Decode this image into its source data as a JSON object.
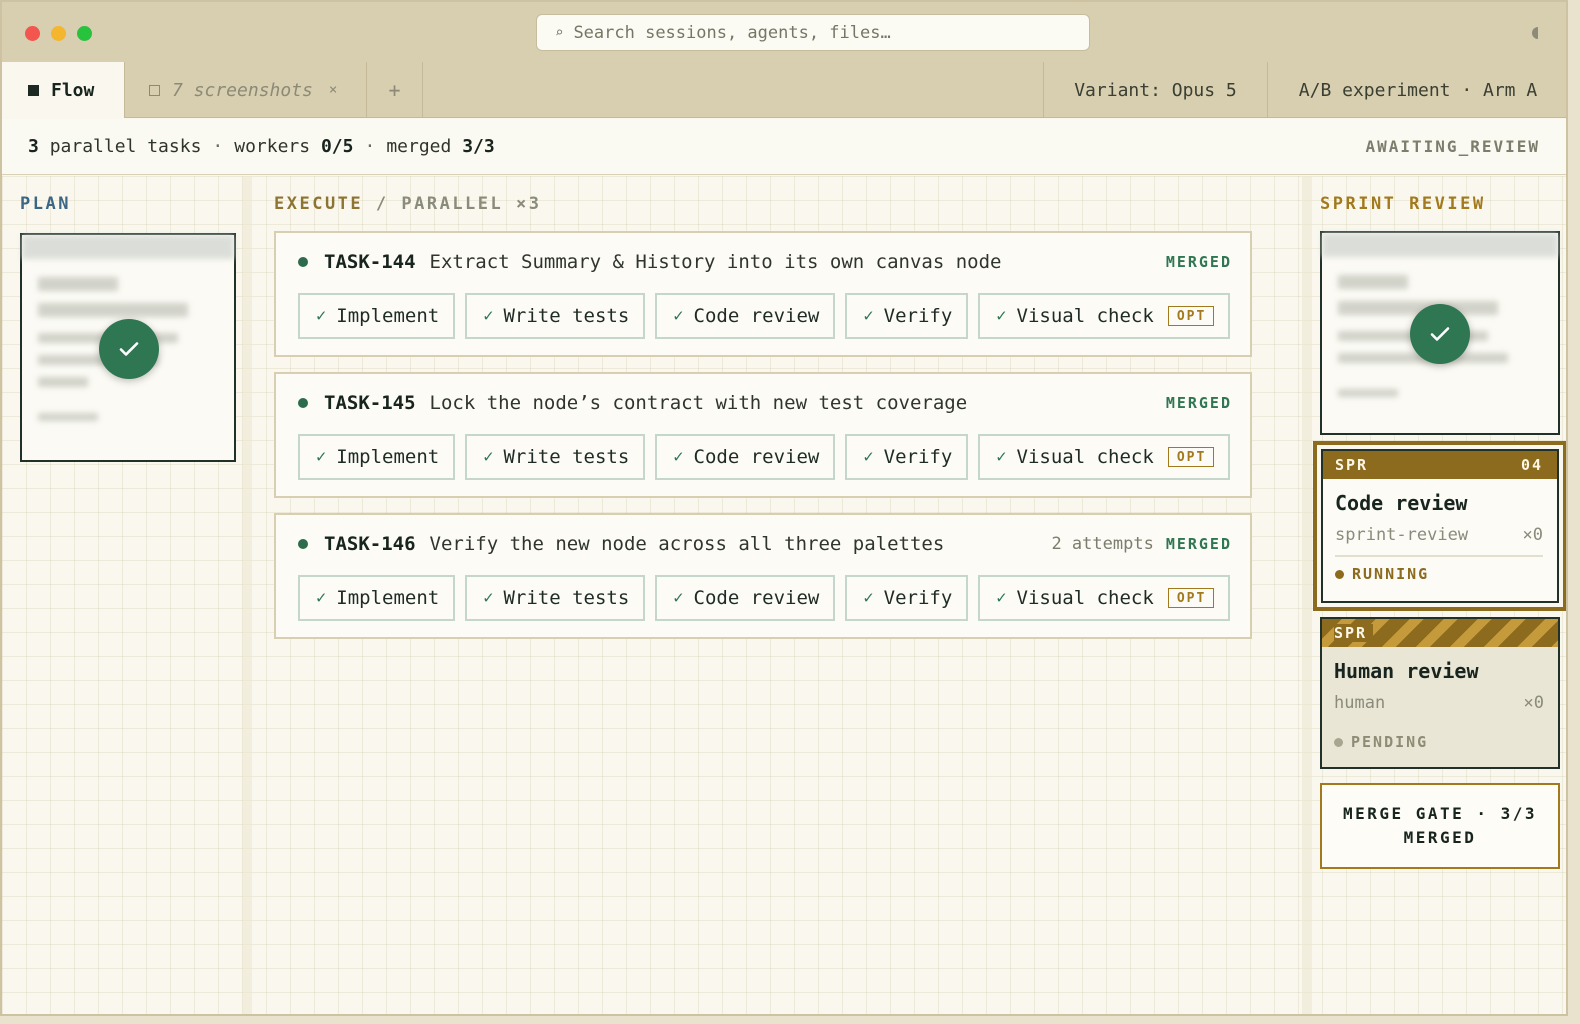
{
  "search": {
    "placeholder": "Search sessions, agents, files…"
  },
  "tabs": {
    "flow": "Flow",
    "screenshots": "7 screenshots",
    "close": "×",
    "add": "+",
    "variant": "Variant: Opus 5",
    "experiment": "A/B experiment · Arm A"
  },
  "status": {
    "tasks_count": "3",
    "tasks_label": "parallel tasks",
    "workers_label": "workers",
    "workers_value": "0/5",
    "merged_label": "merged",
    "merged_value": "3/3",
    "state": "AWAITING_REVIEW"
  },
  "columns": {
    "plan": "PLAN",
    "execute": "EXECUTE",
    "parallel": "/ PARALLEL ×3",
    "sprint_review": "SPRINT REVIEW"
  },
  "tasks": [
    {
      "id": "TASK-144",
      "title": "Extract Summary & History into its own canvas node",
      "attempts": "",
      "status": "MERGED",
      "steps": [
        "Implement",
        "Write tests",
        "Code review",
        "Verify",
        "Visual check"
      ],
      "opt_label": "OPT"
    },
    {
      "id": "TASK-145",
      "title": "Lock the node’s contract with new test coverage",
      "attempts": "",
      "status": "MERGED",
      "steps": [
        "Implement",
        "Write tests",
        "Code review",
        "Verify",
        "Visual check"
      ],
      "opt_label": "OPT"
    },
    {
      "id": "TASK-146",
      "title": "Verify the new node across all three palettes",
      "attempts": "2 attempts",
      "status": "MERGED",
      "steps": [
        "Implement",
        "Write tests",
        "Code review",
        "Verify",
        "Visual check"
      ],
      "opt_label": "OPT"
    }
  ],
  "sprint": {
    "code_review": {
      "tag": "SPR",
      "number": "04",
      "title": "Code review",
      "agent": "sprint-review",
      "count": "×0",
      "state": "RUNNING",
      "state_color": "#8c6a1e"
    },
    "human_review": {
      "tag": "SPR",
      "title": "Human review",
      "agent": "human",
      "count": "×0",
      "state": "PENDING",
      "state_color": "#a9a58f"
    },
    "merge_gate": {
      "line1": "MERGE GATE · 3/3",
      "line2": "MERGED"
    }
  },
  "colors": {
    "accent_green": "#2f7652",
    "accent_gold": "#8c6a1e",
    "plan_blue": "#3b6684"
  }
}
